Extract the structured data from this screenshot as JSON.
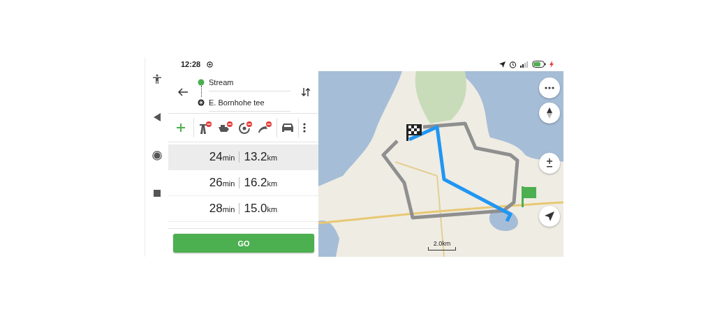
{
  "status_bar": {
    "time": "12:28"
  },
  "route_points": [
    {
      "kind": "start",
      "label": "Stream"
    },
    {
      "kind": "finish",
      "label": "E. Bornhohe tee"
    }
  ],
  "toolbar": [
    {
      "kind": "add"
    },
    {
      "kind": "avoid-highway"
    },
    {
      "kind": "avoid-ferry"
    },
    {
      "kind": "avoid-toll"
    },
    {
      "kind": "avoid-unpaved"
    },
    {
      "kind": "car"
    },
    {
      "kind": "more"
    }
  ],
  "routes": [
    {
      "time": "24",
      "time_unit": "min",
      "distance": "13.2",
      "distance_unit": "km",
      "selected": true
    },
    {
      "time": "26",
      "time_unit": "min",
      "distance": "16.2",
      "distance_unit": "km",
      "selected": false
    },
    {
      "time": "28",
      "time_unit": "min",
      "distance": "15.0",
      "distance_unit": "km",
      "selected": false
    }
  ],
  "go_button": "GO",
  "map": {
    "kind": "picture",
    "scale": "2.0km"
  }
}
